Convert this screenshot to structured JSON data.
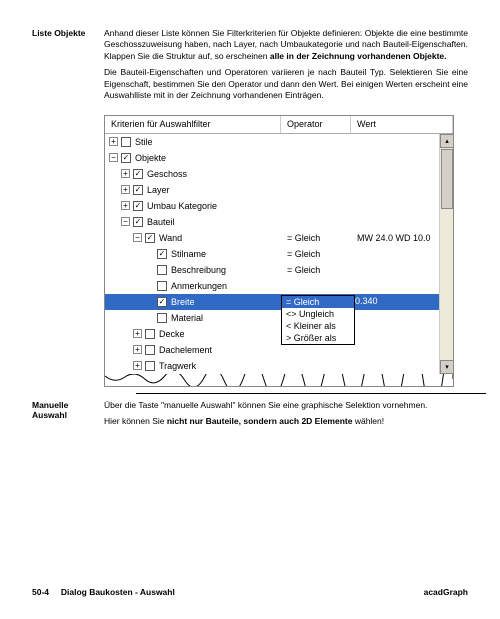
{
  "sections": {
    "liste_objekte": {
      "title": "Liste Objekte",
      "p1a": "Anhand dieser Liste können Sie Filterkriterien für Objekte definieren: Objekte die eine bestimmte Geschosszuweisung haben, nach Layer, nach Umbaukategorie und nach Bauteil-Eigenschaften. Klappen Sie die Struktur auf, so erscheinen ",
      "p1b": "alle in der Zeichnung vorhandenen Objekte.",
      "p2": "Die Bauteil-Eigenschaften und Operatoren variieren je nach Bauteil Typ. Selektieren Sie eine Eigenschaft, bestimmen Sie den Operator und dann den Wert. Bei einigen Werten erscheint eine Auswahlliste mit in der Zeichnung vorhandenen Einträgen."
    },
    "manuelle_auswahl": {
      "title": "Manuelle Auswahl",
      "p1": "Über die Taste \"manuelle Auswahl\" können Sie eine graphische Selektion vornehmen.",
      "p2a": "Hier können Sie ",
      "p2b": "nicht nur Bauteile, sondern auch 2D Elemente",
      "p2c": " wählen!"
    }
  },
  "screenshot": {
    "headers": {
      "col1": "Kriterien für Auswahlfilter",
      "col2": "Operator",
      "col3": "Wert"
    },
    "tree": {
      "stile": "Stile",
      "objekte": "Objekte",
      "geschoss": "Geschoss",
      "layer": "Layer",
      "umbau": "Umbau Kategorie",
      "bauteil": "Bauteil",
      "wand": "Wand",
      "stilname": "Stilname",
      "beschreibung": "Beschreibung",
      "anmerkungen": "Anmerkungen",
      "breite": "Breite",
      "material": "Material",
      "decke": "Decke",
      "dachelement": "Dachelement",
      "tragwerk": "Tragwerk"
    },
    "ops": {
      "wand": "= Gleich",
      "stilname": "= Gleich",
      "beschreibung": "= Gleich",
      "breite": "= Gleich"
    },
    "vals": {
      "wand": "MW 24.0 WD 10.0",
      "breite": "0.340"
    },
    "popup": {
      "opt1": "= Gleich",
      "opt2": "<> Ungleich",
      "opt3": "<  Kleiner als",
      "opt4": ">  Größer als"
    },
    "expand_plus": "+",
    "expand_minus": "−",
    "dropdown_arrow": "▾",
    "scroll_up": "▴",
    "scroll_down": "▾"
  },
  "footer": {
    "page": "50-4",
    "title": "Dialog Baukosten - Auswahl",
    "brand": "acadGraph"
  }
}
